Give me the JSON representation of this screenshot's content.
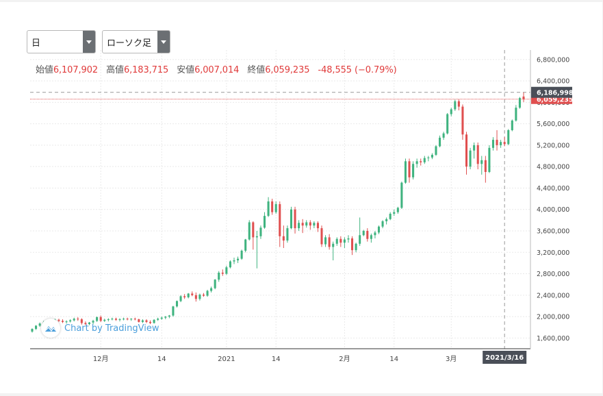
{
  "controls": {
    "period": "日",
    "chart_type": "ローソク足"
  },
  "legend": {
    "open_label": "始値",
    "open": "6,107,902",
    "high_label": "高値",
    "high": "6,183,715",
    "low_label": "安値",
    "low": "6,007,014",
    "close_label": "終値",
    "close": "6,059,235",
    "change": "-48,555 (−0.79%)"
  },
  "watermark": "Chart by TradingView",
  "colors": {
    "up": "#3fb37f",
    "down": "#e04f4f",
    "price_tag": "#e04f4f",
    "dark_tag": "#4a4f58",
    "watermark": "#4a9edb"
  },
  "chart_data": {
    "type": "candlestick",
    "y_axis": {
      "min": 1400000,
      "max": 6900000,
      "position": "right",
      "ticks": [
        1600000,
        2000000,
        2400000,
        2800000,
        3200000,
        3600000,
        4000000,
        4400000,
        4800000,
        5200000,
        5600000,
        6000000,
        6400000,
        6800000
      ],
      "tick_labels": [
        "1,600,000",
        "2,000,000",
        "2,400,000",
        "2,800,000",
        "3,200,000",
        "3,600,000",
        "4,000,000",
        "4,400,000",
        "4,800,000",
        "5,200,000",
        "5,600,000",
        "6,000,000",
        "6,400,000",
        "6,800,000"
      ]
    },
    "x_axis": {
      "labels": [
        {
          "text": "12月",
          "index": 18
        },
        {
          "text": "14",
          "index": 34
        },
        {
          "text": "2021",
          "index": 51
        },
        {
          "text": "14",
          "index": 64
        },
        {
          "text": "2月",
          "index": 82
        },
        {
          "text": "14",
          "index": 95
        },
        {
          "text": "3月",
          "index": 110
        }
      ],
      "crosshair_date": "2021/3/16",
      "crosshair_index": 124
    },
    "crosshair_price": {
      "value": 6186998,
      "label": "6,186,998"
    },
    "last_price": {
      "value": 6059235,
      "label": "6,059,235"
    },
    "candles": [
      [
        1720000,
        1780000,
        1700000,
        1770000
      ],
      [
        1770000,
        1840000,
        1750000,
        1830000
      ],
      [
        1830000,
        1890000,
        1810000,
        1870000
      ],
      [
        1870000,
        1920000,
        1840000,
        1890000
      ],
      [
        1890000,
        1930000,
        1850000,
        1880000
      ],
      [
        1880000,
        1930000,
        1860000,
        1910000
      ],
      [
        1910000,
        1960000,
        1890000,
        1940000
      ],
      [
        1940000,
        1960000,
        1900000,
        1920000
      ],
      [
        1920000,
        1950000,
        1880000,
        1900000
      ],
      [
        1900000,
        1930000,
        1870000,
        1910000
      ],
      [
        1910000,
        1950000,
        1890000,
        1930000
      ],
      [
        1930000,
        1980000,
        1910000,
        1960000
      ],
      [
        1960000,
        1990000,
        1920000,
        1950000
      ],
      [
        1950000,
        1970000,
        1850000,
        1880000
      ],
      [
        1880000,
        1910000,
        1840000,
        1860000
      ],
      [
        1860000,
        1900000,
        1840000,
        1890000
      ],
      [
        1890000,
        1940000,
        1860000,
        1920000
      ],
      [
        1920000,
        2000000,
        1900000,
        1990000
      ],
      [
        1990000,
        2020000,
        1900000,
        1920000
      ],
      [
        1920000,
        1960000,
        1900000,
        1940000
      ],
      [
        1940000,
        1970000,
        1910000,
        1950000
      ],
      [
        1950000,
        1980000,
        1930000,
        1960000
      ],
      [
        1960000,
        1980000,
        1920000,
        1940000
      ],
      [
        1940000,
        1970000,
        1910000,
        1950000
      ],
      [
        1950000,
        1980000,
        1930000,
        1960000
      ],
      [
        1960000,
        1980000,
        1930000,
        1950000
      ],
      [
        1950000,
        1970000,
        1920000,
        1960000
      ],
      [
        1960000,
        1980000,
        1930000,
        1950000
      ],
      [
        1950000,
        1960000,
        1890000,
        1900000
      ],
      [
        1900000,
        1950000,
        1880000,
        1930000
      ],
      [
        1930000,
        1950000,
        1880000,
        1900000
      ],
      [
        1900000,
        1930000,
        1860000,
        1880000
      ],
      [
        1880000,
        1950000,
        1870000,
        1940000
      ],
      [
        1940000,
        1980000,
        1920000,
        1960000
      ],
      [
        1960000,
        2000000,
        1940000,
        1980000
      ],
      [
        1980000,
        2010000,
        1950000,
        2000000
      ],
      [
        2000000,
        2030000,
        1970000,
        2020000
      ],
      [
        2020000,
        2200000,
        2000000,
        2190000
      ],
      [
        2190000,
        2300000,
        2170000,
        2290000
      ],
      [
        2290000,
        2400000,
        2270000,
        2380000
      ],
      [
        2380000,
        2420000,
        2330000,
        2360000
      ],
      [
        2360000,
        2440000,
        2340000,
        2430000
      ],
      [
        2430000,
        2470000,
        2380000,
        2400000
      ],
      [
        2400000,
        2450000,
        2280000,
        2330000
      ],
      [
        2330000,
        2430000,
        2300000,
        2410000
      ],
      [
        2410000,
        2440000,
        2370000,
        2390000
      ],
      [
        2390000,
        2500000,
        2370000,
        2480000
      ],
      [
        2480000,
        2560000,
        2450000,
        2530000
      ],
      [
        2530000,
        2700000,
        2510000,
        2690000
      ],
      [
        2690000,
        2850000,
        2650000,
        2820000
      ],
      [
        2820000,
        2880000,
        2760000,
        2800000
      ],
      [
        2800000,
        2950000,
        2780000,
        2920000
      ],
      [
        2920000,
        3050000,
        2900000,
        3030000
      ],
      [
        3030000,
        3100000,
        2980000,
        3050000
      ],
      [
        3050000,
        3120000,
        3000000,
        3080000
      ],
      [
        3080000,
        3250000,
        3060000,
        3230000
      ],
      [
        3230000,
        3450000,
        3200000,
        3440000
      ],
      [
        3440000,
        3800000,
        3420000,
        3760000
      ],
      [
        3760000,
        3780000,
        3250000,
        3480000
      ],
      [
        3480000,
        3600000,
        2900000,
        3500000
      ],
      [
        3500000,
        3700000,
        3450000,
        3660000
      ],
      [
        3660000,
        3950000,
        3640000,
        3880000
      ],
      [
        3880000,
        4230000,
        3860000,
        4150000
      ],
      [
        4150000,
        4200000,
        3900000,
        3950000
      ],
      [
        3950000,
        4150000,
        3920000,
        4100000
      ],
      [
        4100000,
        4150000,
        3300000,
        3500000
      ],
      [
        3500000,
        3700000,
        3280000,
        3420000
      ],
      [
        3420000,
        3700000,
        3380000,
        3650000
      ],
      [
        3650000,
        4050000,
        3630000,
        4000000
      ],
      [
        4000000,
        4050000,
        3550000,
        3650000
      ],
      [
        3650000,
        3800000,
        3600000,
        3750000
      ],
      [
        3750000,
        3820000,
        3560000,
        3700000
      ],
      [
        3700000,
        3800000,
        3660000,
        3760000
      ],
      [
        3760000,
        3800000,
        3620000,
        3700000
      ],
      [
        3700000,
        3780000,
        3650000,
        3750000
      ],
      [
        3750000,
        3780000,
        3580000,
        3650000
      ],
      [
        3650000,
        3700000,
        3300000,
        3350000
      ],
      [
        3350000,
        3520000,
        3300000,
        3480000
      ],
      [
        3480000,
        3540000,
        3250000,
        3300000
      ],
      [
        3300000,
        3400000,
        3050000,
        3360000
      ],
      [
        3360000,
        3480000,
        3320000,
        3450000
      ],
      [
        3450000,
        3500000,
        3300000,
        3380000
      ],
      [
        3380000,
        3480000,
        3280000,
        3440000
      ],
      [
        3440000,
        3520000,
        3380000,
        3460000
      ],
      [
        3460000,
        3500000,
        3150000,
        3240000
      ],
      [
        3240000,
        3380000,
        3200000,
        3360000
      ],
      [
        3360000,
        3850000,
        3320000,
        3520000
      ],
      [
        3520000,
        3620000,
        3500000,
        3600000
      ],
      [
        3600000,
        3650000,
        3400000,
        3450000
      ],
      [
        3450000,
        3550000,
        3380000,
        3520000
      ],
      [
        3520000,
        3600000,
        3460000,
        3570000
      ],
      [
        3570000,
        3700000,
        3540000,
        3680000
      ],
      [
        3680000,
        3800000,
        3650000,
        3780000
      ],
      [
        3780000,
        3850000,
        3720000,
        3820000
      ],
      [
        3820000,
        3950000,
        3800000,
        3920000
      ],
      [
        3920000,
        4000000,
        3880000,
        3950000
      ],
      [
        3950000,
        4050000,
        3920000,
        4030000
      ],
      [
        4030000,
        4520000,
        4010000,
        4500000
      ],
      [
        4500000,
        4950000,
        4480000,
        4900000
      ],
      [
        4900000,
        4950000,
        4500000,
        4600000
      ],
      [
        4600000,
        4900000,
        4560000,
        4850000
      ],
      [
        4850000,
        4950000,
        4780000,
        4900000
      ],
      [
        4900000,
        4950000,
        4820000,
        4880000
      ],
      [
        4880000,
        5000000,
        4850000,
        4960000
      ],
      [
        4960000,
        5000000,
        4900000,
        4970000
      ],
      [
        4970000,
        5050000,
        4940000,
        5020000
      ],
      [
        5020000,
        5200000,
        5000000,
        5180000
      ],
      [
        5180000,
        5380000,
        5160000,
        5340000
      ],
      [
        5340000,
        5450000,
        5300000,
        5420000
      ],
      [
        5420000,
        5800000,
        5400000,
        5780000
      ],
      [
        5780000,
        5900000,
        5740000,
        5870000
      ],
      [
        5870000,
        6050000,
        5840000,
        6020000
      ],
      [
        6020000,
        6060000,
        5850000,
        5920000
      ],
      [
        5920000,
        5960000,
        5300000,
        5400000
      ],
      [
        5400000,
        5450000,
        4650000,
        4800000
      ],
      [
        4800000,
        5150000,
        4750000,
        5100000
      ],
      [
        5100000,
        5250000,
        4950000,
        5200000
      ],
      [
        5200000,
        5250000,
        4750000,
        4850000
      ],
      [
        4850000,
        5000000,
        4650000,
        4920000
      ],
      [
        4920000,
        5000000,
        4500000,
        4700000
      ],
      [
        4700000,
        5200000,
        4680000,
        5150000
      ],
      [
        5150000,
        5350000,
        5100000,
        5300000
      ],
      [
        5300000,
        5480000,
        5100000,
        5200000
      ],
      [
        5200000,
        5300000,
        5150000,
        5260000
      ],
      [
        5260000,
        5350000,
        5180000,
        5220000
      ],
      [
        5220000,
        5500000,
        5200000,
        5480000
      ],
      [
        5480000,
        5680000,
        5460000,
        5660000
      ],
      [
        5660000,
        5950000,
        5640000,
        5900000
      ],
      [
        5900000,
        6100000,
        5880000,
        6080000
      ],
      [
        6108000,
        6184000,
        6007000,
        6059000
      ]
    ]
  }
}
